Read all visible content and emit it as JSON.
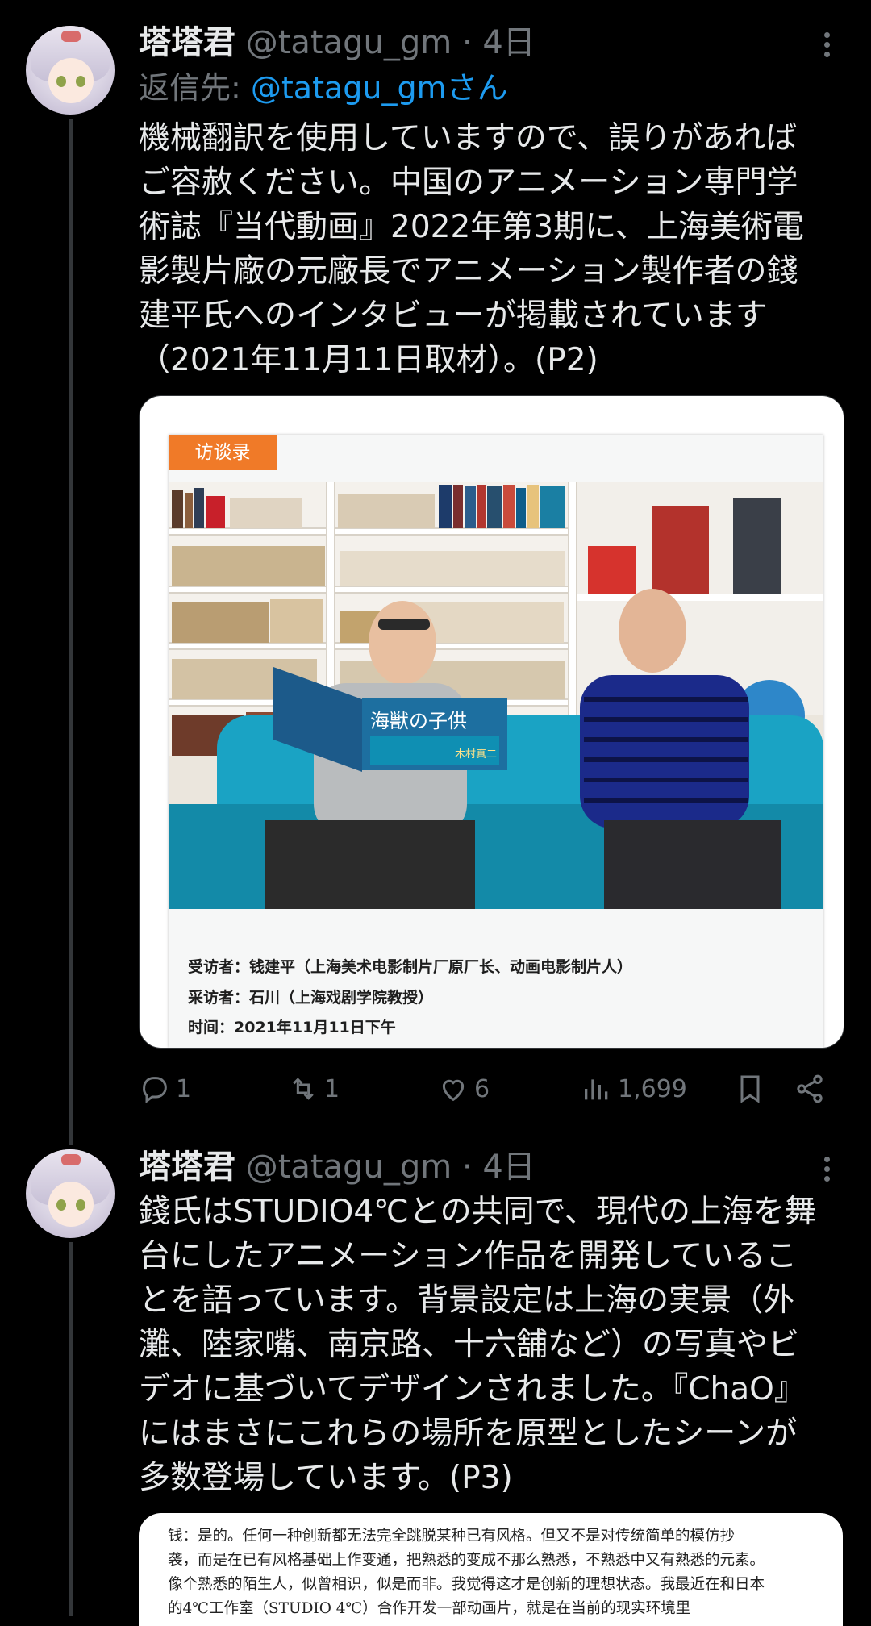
{
  "tweets": [
    {
      "name": "塔塔君",
      "handle": "@tatagu_gm · 4日",
      "reply_to_prefix": "返信先: ",
      "reply_to_mention": "@tatagu_gmさん",
      "text": "機械翻訳を使用していますので、誤りがあれば\nご容赦ください。中国のアニメーション専門学\n術誌『当代動画』2022年第3期に、上海美術電\n影製片廠の元廠長でアニメーション製作者の錢\n建平氏へのインタビューが掲載されています\n（2021年11月11日取材）。(P2)",
      "media": {
        "tag": "访谈录",
        "book_title": "海獣の子供",
        "book_subtitle": "木村真二",
        "caption_lines": [
          "受访者：钱建平（上海美术电影制片厂原厂长、动画电影制片人）",
          "采访者：石川（上海戏剧学院教授）",
          "时间：2021年11月11日下午"
        ]
      },
      "actions": {
        "reply_count": "1",
        "retweet_count": "1",
        "like_count": "6",
        "view_count": "1,699"
      }
    },
    {
      "name": "塔塔君",
      "handle": "@tatagu_gm · 4日",
      "text": "錢氏はSTUDIO4℃との共同で、現代の上海を舞\n台にしたアニメーション作品を開発しているこ\nとを語っています。背景設定は上海の実景（外\n灘、陸家嘴、南京路、十六舗など）の写真やビ\nデオに基づいてデザインされました。『ChaO』\nにはまさにこれらの場所を原型としたシーンが\n多数登場しています。(P3)",
      "media_text_lines": [
        "钱：是的。任何一种创新都无法完全跳脱某种已有风格。但又不是对传统简单的模仿抄",
        "袭，而是在已有风格基础上作变通，把熟悉的变成不那么熟悉，不熟悉中又有熟悉的元素。",
        "像个熟悉的陌生人，似曾相识，似是而非。我觉得这才是创新的理想状态。我最近在和日本",
        "的4℃工作室（STUDIO 4℃）合作开发一部动画片，就是在当前的现实环境里"
      ]
    }
  ],
  "colors": {
    "background": "#000000",
    "text": "#e7e9ea",
    "secondary": "#71767b",
    "link": "#1d9bf0",
    "tag": "#f07a28",
    "sofa": "#1aa3c4"
  }
}
